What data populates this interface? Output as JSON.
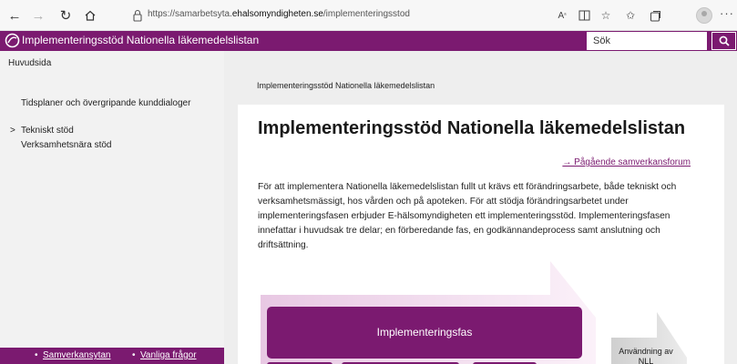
{
  "browser": {
    "url_prefix": "https://samarbetsyta.",
    "url_domain": "ehalsomyndigheten.se",
    "url_path": "/implementeringsstod"
  },
  "header": {
    "title": "Implementeringsstöd Nationella läkemedelslistan",
    "search_placeholder": "Sök"
  },
  "sidebar": {
    "home": "Huvudsida",
    "items": [
      {
        "label": "Tidsplaner och övergripande kunddialoger"
      },
      {
        "label": "Tekniskt stöd",
        "caret": ">"
      },
      {
        "label": "Verksamhetsnära stöd"
      }
    ],
    "footer_links": [
      "Samverkansytan",
      "Vanliga frågor"
    ],
    "footer_bullet": "•"
  },
  "main": {
    "breadcrumb": "Implementeringsstöd Nationella läkemedelslistan",
    "title": "Implementeringsstöd Nationella läkemedelslistan",
    "related_link": "→ Pågående samverkansforum",
    "intro": "För att implementera Nationella läkemedelslistan fullt ut krävs ett förändringsarbete, både tekniskt och verksamhetsmässigt, hos vården och på apoteken. För att stödja förändringsarbetet under implementeringsfasen erbjuder E-hälsomyndigheten ett implementeringsstöd. Implementeringsfasen innefattar i huvudsak tre delar; en förberedande fas, en godkännandeprocess samt anslutning och driftsättning.",
    "diagram": {
      "phase_label": "Implementeringsfas",
      "use_label": "Användning av NLL"
    }
  },
  "colors": {
    "brand": "#7b1a70",
    "arrow_light": "#f1dcee",
    "gray_arrow": "#d9d9d9"
  },
  "icons": [
    "back-arrow-icon",
    "forward-arrow-icon",
    "refresh-icon",
    "home-icon",
    "lock-icon",
    "read-aloud-icon",
    "reader-view-icon",
    "favorite-star-icon",
    "favorites-icon",
    "collections-icon",
    "profile-icon",
    "more-icon",
    "logo-icon",
    "search-icon"
  ]
}
